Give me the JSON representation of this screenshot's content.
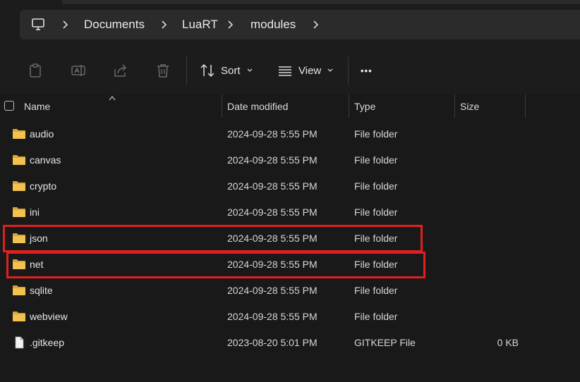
{
  "address_bar": {
    "icon": "computer-icon",
    "breadcrumbs": [
      "Documents",
      "LuaRT",
      "modules"
    ]
  },
  "toolbar": {
    "icons": [
      "clipboard-icon",
      "rename-icon",
      "share-icon",
      "trash-icon"
    ],
    "sort_label": "Sort",
    "view_label": "View",
    "more_label": "•••"
  },
  "columns": {
    "name": "Name",
    "date": "Date modified",
    "type": "Type",
    "size": "Size"
  },
  "files": [
    {
      "name": "audio",
      "date": "2024-09-28 5:55 PM",
      "type": "File folder",
      "size": "",
      "icon": "folder-icon"
    },
    {
      "name": "canvas",
      "date": "2024-09-28 5:55 PM",
      "type": "File folder",
      "size": "",
      "icon": "folder-icon"
    },
    {
      "name": "crypto",
      "date": "2024-09-28 5:55 PM",
      "type": "File folder",
      "size": "",
      "icon": "folder-icon"
    },
    {
      "name": "ini",
      "date": "2024-09-28 5:55 PM",
      "type": "File folder",
      "size": "",
      "icon": "folder-icon"
    },
    {
      "name": "json",
      "date": "2024-09-28 5:55 PM",
      "type": "File folder",
      "size": "",
      "icon": "folder-icon"
    },
    {
      "name": "net",
      "date": "2024-09-28 5:55 PM",
      "type": "File folder",
      "size": "",
      "icon": "folder-icon"
    },
    {
      "name": "sqlite",
      "date": "2024-09-28 5:55 PM",
      "type": "File folder",
      "size": "",
      "icon": "folder-icon"
    },
    {
      "name": "webview",
      "date": "2024-09-28 5:55 PM",
      "type": "File folder",
      "size": "",
      "icon": "folder-icon"
    },
    {
      "name": ".gitkeep",
      "date": "2023-08-20 5:01 PM",
      "type": "GITKEEP File",
      "size": "0 KB",
      "icon": "file-icon"
    }
  ],
  "colors": {
    "background": "#191919",
    "folder": "#f2c14e",
    "highlight": "#e02020"
  }
}
